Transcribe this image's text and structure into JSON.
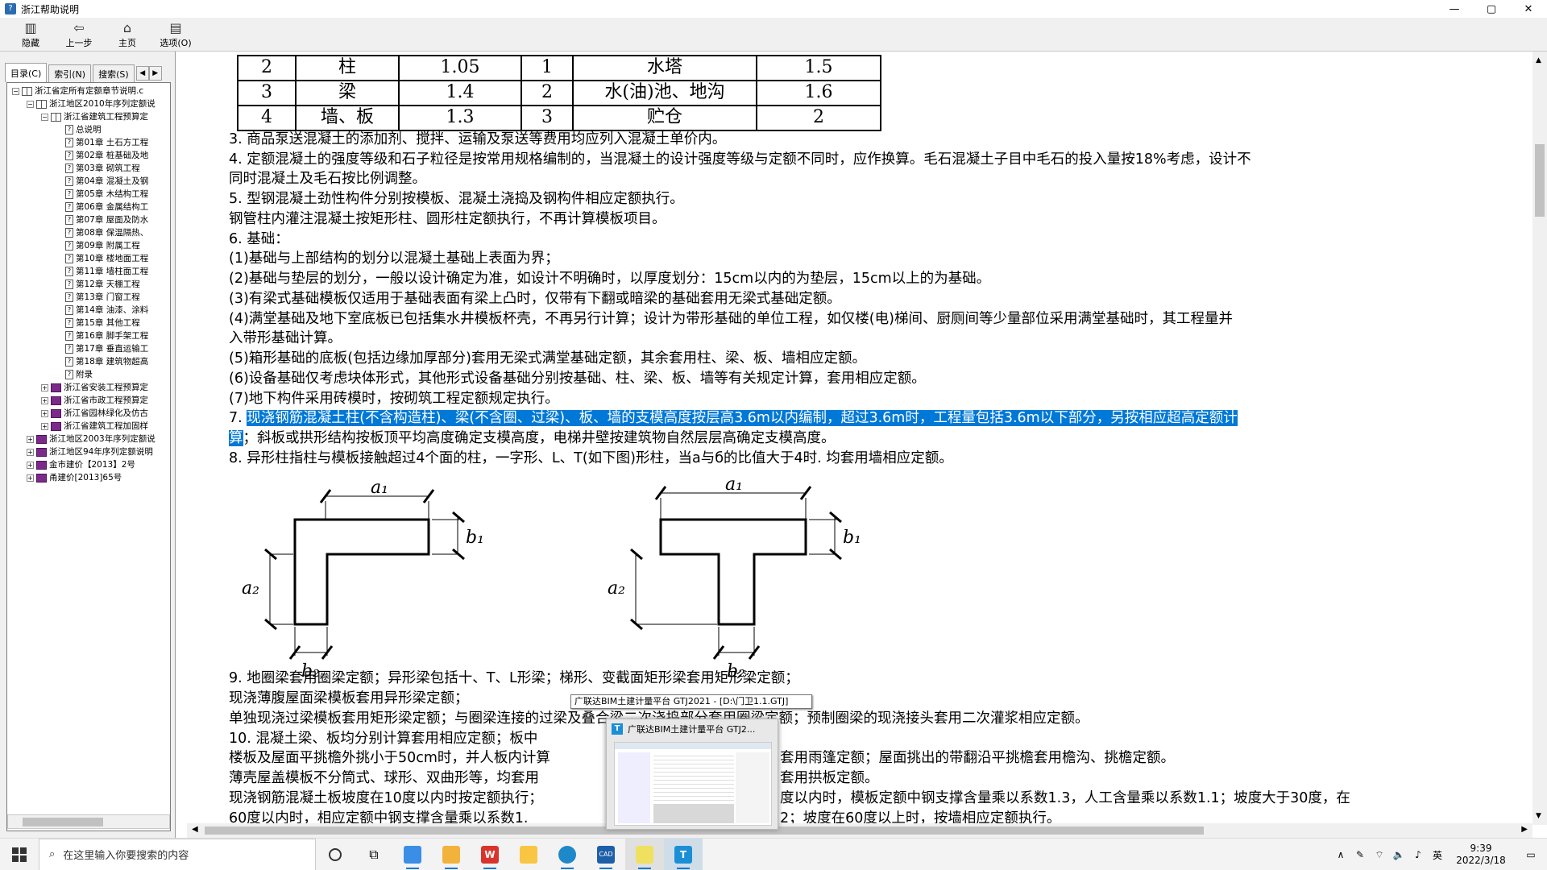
{
  "window": {
    "title": "浙江帮助说明",
    "minimize": "—",
    "maximize": "▢",
    "close": "✕"
  },
  "toolbar": [
    {
      "label": "隐藏",
      "icon": "hide-icon"
    },
    {
      "label": "上一步",
      "icon": "back-arrow-icon"
    },
    {
      "label": "主页",
      "icon": "home-icon"
    },
    {
      "label": "选项(O)",
      "icon": "options-icon"
    }
  ],
  "left_tabs": {
    "contents": "目录(C)",
    "index": "索引(N)",
    "search": "搜索(S)"
  },
  "tree": [
    {
      "level": 0,
      "exp": "−",
      "icon": "open",
      "text": "浙江省定所有定额章节说明.c"
    },
    {
      "level": 1,
      "exp": "−",
      "icon": "open",
      "text": "浙江地区2010年序列定额说"
    },
    {
      "level": 2,
      "exp": "−",
      "icon": "open",
      "text": "浙江省建筑工程预算定"
    },
    {
      "level": 3,
      "exp": "",
      "icon": "page",
      "text": "总说明"
    },
    {
      "level": 3,
      "exp": "",
      "icon": "page",
      "text": "第01章 土石方工程"
    },
    {
      "level": 3,
      "exp": "",
      "icon": "page",
      "text": "第02章 桩基础及地"
    },
    {
      "level": 3,
      "exp": "",
      "icon": "page",
      "text": "第03章 砌筑工程"
    },
    {
      "level": 3,
      "exp": "",
      "icon": "page",
      "text": "第04章 混凝土及钢"
    },
    {
      "level": 3,
      "exp": "",
      "icon": "page",
      "text": "第05章 木结构工程"
    },
    {
      "level": 3,
      "exp": "",
      "icon": "page",
      "text": "第06章 金属结构工"
    },
    {
      "level": 3,
      "exp": "",
      "icon": "page",
      "text": "第07章 屋面及防水"
    },
    {
      "level": 3,
      "exp": "",
      "icon": "page",
      "text": "第08章 保温隔热、"
    },
    {
      "level": 3,
      "exp": "",
      "icon": "page",
      "text": "第09章 附属工程"
    },
    {
      "level": 3,
      "exp": "",
      "icon": "page",
      "text": "第10章 楼地面工程"
    },
    {
      "level": 3,
      "exp": "",
      "icon": "page",
      "text": "第11章 墙柱面工程"
    },
    {
      "level": 3,
      "exp": "",
      "icon": "page",
      "text": "第12章 天棚工程"
    },
    {
      "level": 3,
      "exp": "",
      "icon": "page",
      "text": "第13章 门窗工程"
    },
    {
      "level": 3,
      "exp": "",
      "icon": "page",
      "text": "第14章 油漆、涂料"
    },
    {
      "level": 3,
      "exp": "",
      "icon": "page",
      "text": "第15章 其他工程"
    },
    {
      "level": 3,
      "exp": "",
      "icon": "page",
      "text": "第16章 脚手架工程"
    },
    {
      "level": 3,
      "exp": "",
      "icon": "page",
      "text": "第17章 垂直运输工"
    },
    {
      "level": 3,
      "exp": "",
      "icon": "page",
      "text": "第18章 建筑物超高"
    },
    {
      "level": 3,
      "exp": "",
      "icon": "page",
      "text": "附录"
    },
    {
      "level": 2,
      "exp": "+",
      "icon": "book",
      "text": "浙江省安装工程预算定"
    },
    {
      "level": 2,
      "exp": "+",
      "icon": "book",
      "text": "浙江省市政工程预算定"
    },
    {
      "level": 2,
      "exp": "+",
      "icon": "book",
      "text": "浙江省园林绿化及仿古"
    },
    {
      "level": 2,
      "exp": "+",
      "icon": "book",
      "text": "浙江省建筑工程加固样"
    },
    {
      "level": 1,
      "exp": "+",
      "icon": "book",
      "text": "浙江地区2003年序列定额说"
    },
    {
      "level": 1,
      "exp": "+",
      "icon": "book",
      "text": "浙江地区94年序列定额说明"
    },
    {
      "level": 1,
      "exp": "+",
      "icon": "book",
      "text": "金市建价【2013】2号"
    },
    {
      "level": 1,
      "exp": "+",
      "icon": "book",
      "text": "甬建价[2013]65号"
    }
  ],
  "table": [
    [
      "2",
      "柱",
      "1.05",
      "1",
      "水塔",
      "1.5"
    ],
    [
      "3",
      "梁",
      "1.4",
      "2",
      "水(油)池、地沟",
      "1.6"
    ],
    [
      "4",
      "墙、板",
      "1.3",
      "3",
      "贮仓",
      "2"
    ]
  ],
  "paragraphs": {
    "p3": "3. 商品泵送混凝土的添加剂、搅拌、运输及泵送等费用均应列入混凝土单价内。",
    "p4a": "4. 定额混凝土的强度等级和石子粒径是按常用规格编制的，当混凝土的设计强度等级与定额不同时，应作换算。毛石混凝土子目中毛石的投入量按18%考虑，设计不",
    "p4b": "同时混凝土及毛石按比例调整。",
    "p5a": "5. 型钢混凝土劲性构件分别按模板、混凝土浇捣及钢构件相应定额执行。",
    "p5b": "钢管柱内灌注混凝土按矩形柱、圆形柱定额执行，不再计算模板项目。",
    "p6": "6. 基础：",
    "p6_1": "(1)基础与上部结构的划分以混凝土基础上表面为界；",
    "p6_2": "(2)基础与垫层的划分，一般以设计确定为准，如设计不明确时，以厚度划分：15cm以内的为垫层，15cm以上的为基础。",
    "p6_3": "(3)有梁式基础模板仅适用于基础表面有梁上凸时，仅带有下翻或暗梁的基础套用无梁式基础定额。",
    "p6_4a": "(4)满堂基础及地下室底板已包括集水井模板杯壳，不再另行计算；设计为带形基础的单位工程，如仅楼(电)梯间、厨厕间等少量部位采用满堂基础时，其工程量并",
    "p6_4b": "入带形基础计算。",
    "p6_5": "(5)箱形基础的底板(包括边缘加厚部分)套用无梁式满堂基础定额，其余套用柱、梁、板、墙相应定额。",
    "p6_6": "(6)设备基础仅考虑块体形式，其他形式设备基础分别按基础、柱、梁、板、墙等有关规定计算，套用相应定额。",
    "p6_7": "(7)地下构件采用砖模时，按砌筑工程定额规定执行。",
    "p7_num": "7. ",
    "p7_hl1": "现浇钢筋混凝土柱(不含构造柱)、梁(不含圈、过梁)、板、墙的支模高度按层高3.6m以内编制，超过3.6m时，工程量包括3.6m以下部分，另按相应超高定额计",
    "p7_hl2": "算",
    "p7_rest": "；斜板或拱形结构按板顶平均高度确定支模高度，电梯井壁按建筑物自然层层高确定支模高度。",
    "p8": "8. 异形柱指柱与模板接触超过4个面的柱，一字形、L、T(如下图)形柱，当a与б的比值大于4时. 均套用墙相应定额。",
    "p9a": "9. 地圈梁套用圈梁定额；异形梁包括十、T、L形梁；梯形、变截面矩形梁套用矩形梁定额；",
    "p9b": "现浇薄腹屋面梁模板套用异形梁定额；",
    "p9c": "单独现浇过梁模板套用矩形梁定额；与圈梁连接的过梁及叠合梁二次浇捣部分套用圈梁定额；预制圈梁的现浇接头套用二次灌浆相应定额。",
    "p10a": "10. 混凝土梁、板均分别计算套用相应定额；板中",
    "p10b": "楼板及屋面平挑檐外挑小于50cm时，并人板内计算",
    "p10b2": "套用雨篷定额；屋面挑出的带翻沿平挑檐套用檐沟、挑檐定额。",
    "p10c": "薄壳屋盖模板不分筒式、球形、双曲形等，均套用",
    "p10c2": "套用拱板定额。",
    "p10d": "现浇钢筋混凝土板坡度在10度以内时按定额执行；",
    "p10d2": "度以内时，模板定额中钢支撑含量乘以系数1.3，人工含量乘以系数1.1；坡度大于30度，在",
    "p10e": "60度以内时，相应定额中钢支撑含量乘以系数1.",
    "p10e2": "2；坡度在60度以上时，按墙相应定额执行。"
  },
  "figure": {
    "a1": "a₁",
    "b1": "b₁",
    "a2": "a₂",
    "b2": "b₂"
  },
  "tooltip": "广联达BIM土建计量平台 GTJ2021 - [D:\\门卫1.1.GTJ]",
  "thumbnail": {
    "title": "广联达BIM土建计量平台 GTJ2..."
  },
  "taskbar": {
    "search_placeholder": "在这里输入你要搜索的内容",
    "apps": [
      "task-view-icon",
      "snipping-icon",
      "notes-icon",
      "wps-icon",
      "file-explorer-icon",
      "edge-icon",
      "cad-icon",
      "help-icon",
      "gtj-icon"
    ],
    "ime": "英",
    "time": "9:39",
    "date": "2022/3/18"
  }
}
